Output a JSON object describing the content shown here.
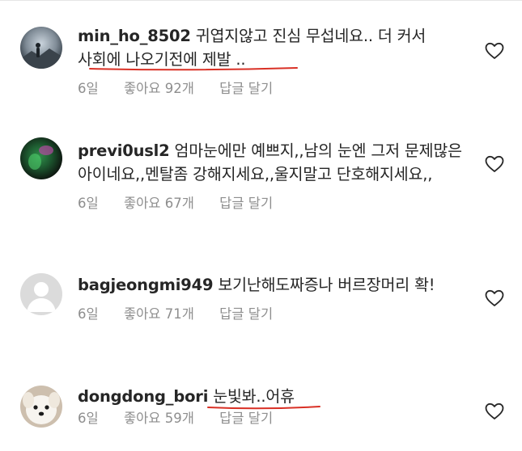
{
  "comments": [
    {
      "username": "min_ho_8502",
      "text": "귀엽지않고 진심 무섭네요.. 더 커서 사회에 나오기전에 제발 ..",
      "age": "6일",
      "likes": "좋아요 92개",
      "reply": "답글 달기",
      "avatar_icon": "avatar-silhouette-mountain"
    },
    {
      "username": "previ0usl2",
      "text": "엄마눈에만 예쁘지,,남의 눈엔 그저 문제많은 아이네요,,멘탈좀 강해지세요,,울지말고 단호해지세요,,",
      "age": "6일",
      "likes": "좋아요 67개",
      "reply": "답글 달기",
      "avatar_icon": "avatar-green-blur"
    },
    {
      "username": "bagjeongmi949",
      "text": "보기난해도짜증나 버르장머리 확!",
      "age": "6일",
      "likes": "좋아요 71개",
      "reply": "답글 달기",
      "avatar_icon": "avatar-default-person"
    },
    {
      "username": "dongdong_bori",
      "text": "눈빛봐..어휴",
      "age": "6일",
      "likes": "좋아요 59개",
      "reply": "답글 달기",
      "avatar_icon": "avatar-white-puppy"
    }
  ],
  "colors": {
    "text": "#262626",
    "meta": "#8e8e8e",
    "underline": "#d93025",
    "heart": "#262626"
  },
  "icons": {
    "like": "heart-outline-icon"
  }
}
